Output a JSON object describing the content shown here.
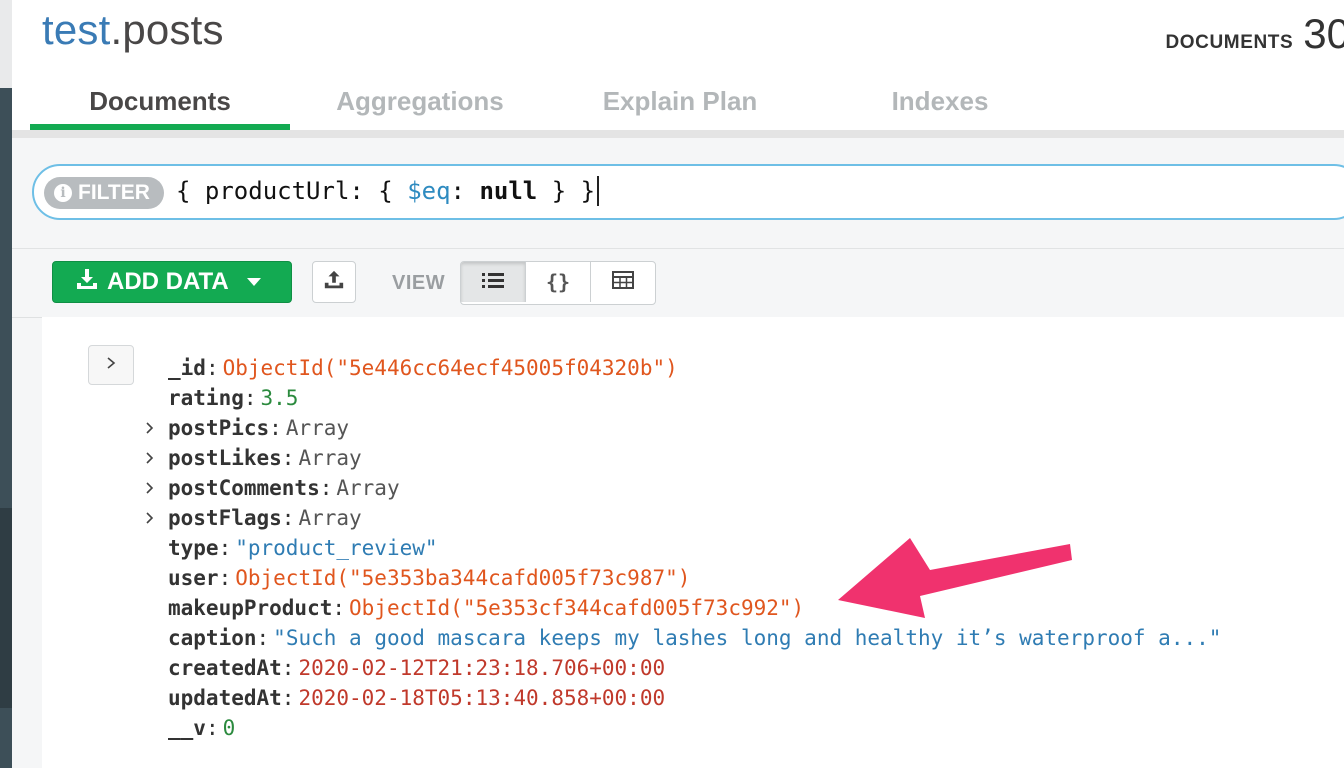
{
  "header": {
    "db_name": "test",
    "collection_name": ".posts",
    "documents_label": "DOCUMENTS",
    "documents_count": "30"
  },
  "tabs": [
    {
      "label": "Documents",
      "active": true
    },
    {
      "label": "Aggregations",
      "active": false
    },
    {
      "label": "Explain Plan",
      "active": false
    },
    {
      "label": "Indexes",
      "active": false
    }
  ],
  "filter": {
    "badge": "FILTER",
    "query_open": "{ productUrl: { ",
    "query_op": "$eq",
    "query_colon": ": ",
    "query_value": "null",
    "query_close": " } }"
  },
  "toolbar": {
    "add_data_label": "ADD DATA",
    "view_label": "VIEW",
    "view_modes": [
      "list-icon",
      "json-icon",
      "table-icon"
    ],
    "active_view": "list"
  },
  "document": {
    "fields": [
      {
        "key": "_id",
        "value": "ObjectId(\"5e446cc64ecf45005f04320b\")",
        "type": "oid",
        "expandable": false
      },
      {
        "key": "rating",
        "value": "3.5",
        "type": "num",
        "expandable": false
      },
      {
        "key": "postPics",
        "value": "Array",
        "type": "arr",
        "expandable": true
      },
      {
        "key": "postLikes",
        "value": "Array",
        "type": "arr",
        "expandable": true
      },
      {
        "key": "postComments",
        "value": "Array",
        "type": "arr",
        "expandable": true
      },
      {
        "key": "postFlags",
        "value": "Array",
        "type": "arr",
        "expandable": true
      },
      {
        "key": "type",
        "value": "\"product_review\"",
        "type": "str",
        "expandable": false
      },
      {
        "key": "user",
        "value": "ObjectId(\"5e353ba344cafd005f73c987\")",
        "type": "oid",
        "expandable": false
      },
      {
        "key": "makeupProduct",
        "value": "ObjectId(\"5e353cf344cafd005f73c992\")",
        "type": "oid",
        "expandable": false
      },
      {
        "key": "caption",
        "value": "\"Such a good mascara keeps my lashes long and healthy it’s waterproof a...\"",
        "type": "str",
        "expandable": false
      },
      {
        "key": "createdAt",
        "value": "2020-02-12T21:23:18.706+00:00",
        "type": "date",
        "expandable": false
      },
      {
        "key": "updatedAt",
        "value": "2020-02-18T05:13:40.858+00:00",
        "type": "date",
        "expandable": false
      },
      {
        "key": "__v",
        "value": "0",
        "type": "num",
        "expandable": false
      }
    ]
  },
  "colors": {
    "accent_green": "#13aa52",
    "filter_border": "#6ebfe6",
    "objectid": "#e0561e",
    "string": "#2f7cb3",
    "date": "#c0392b",
    "number": "#2b8a3e",
    "arrow": "#f0326e"
  }
}
